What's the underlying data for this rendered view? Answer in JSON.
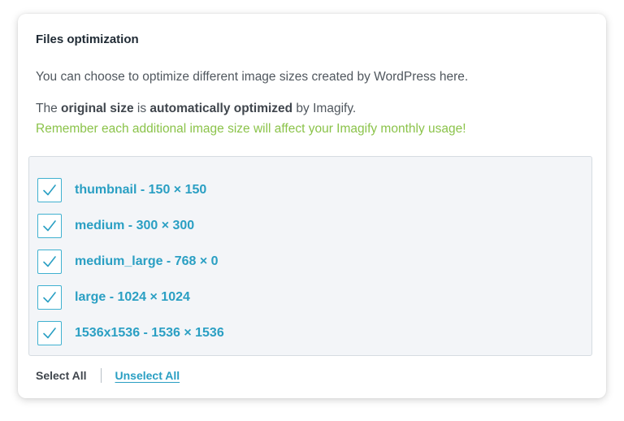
{
  "section": {
    "title": "Files optimization",
    "intro": "You can choose to optimize different image sizes created by WordPress here.",
    "note_prefix": "The ",
    "note_bold_1": "original size",
    "note_middle": " is ",
    "note_bold_2": "automatically optimized",
    "note_suffix": " by Imagify.",
    "warning": "Remember each additional image size will affect your Imagify monthly usage!"
  },
  "sizes": [
    {
      "label": "thumbnail - 150 × 150",
      "checked": true
    },
    {
      "label": "medium - 300 × 300",
      "checked": true
    },
    {
      "label": "medium_large - 768 × 0",
      "checked": true
    },
    {
      "label": "large - 1024 × 1024",
      "checked": true
    },
    {
      "label": "1536x1536 - 1536 × 1536",
      "checked": true
    }
  ],
  "actions": {
    "select_all": "Select All",
    "unselect_all": "Unselect All"
  },
  "colors": {
    "accent": "#2a9fc3",
    "checkbox_border": "#40b1d0",
    "warning": "#8bc34a",
    "text": "#50575e"
  }
}
